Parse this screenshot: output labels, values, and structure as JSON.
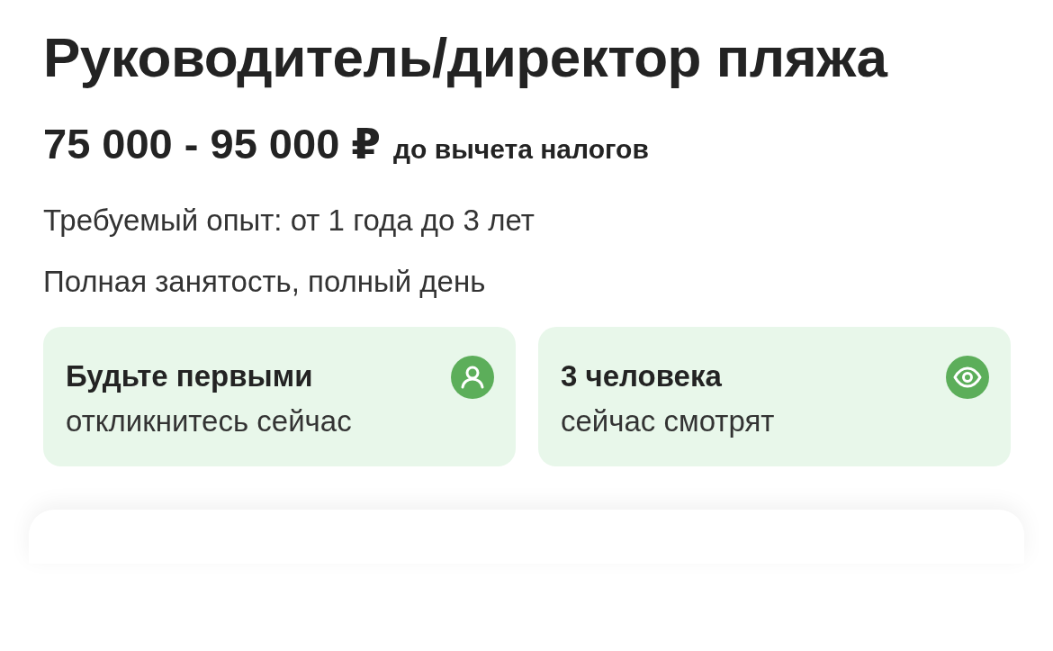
{
  "title": "Руководитель/директор пляжа",
  "salary": {
    "amount": "75 000 - 95 000 ₽",
    "note": "до вычета налогов"
  },
  "details": [
    "Требуемый опыт: от 1 года до 3 лет",
    "Полная занятость, полный день"
  ],
  "cards": [
    {
      "kind": "person",
      "title": "Будьте первыми",
      "subtitle": "откликнитесь сейчас"
    },
    {
      "kind": "eye",
      "title": "3 человека",
      "subtitle": "сейчас смотрят"
    }
  ]
}
